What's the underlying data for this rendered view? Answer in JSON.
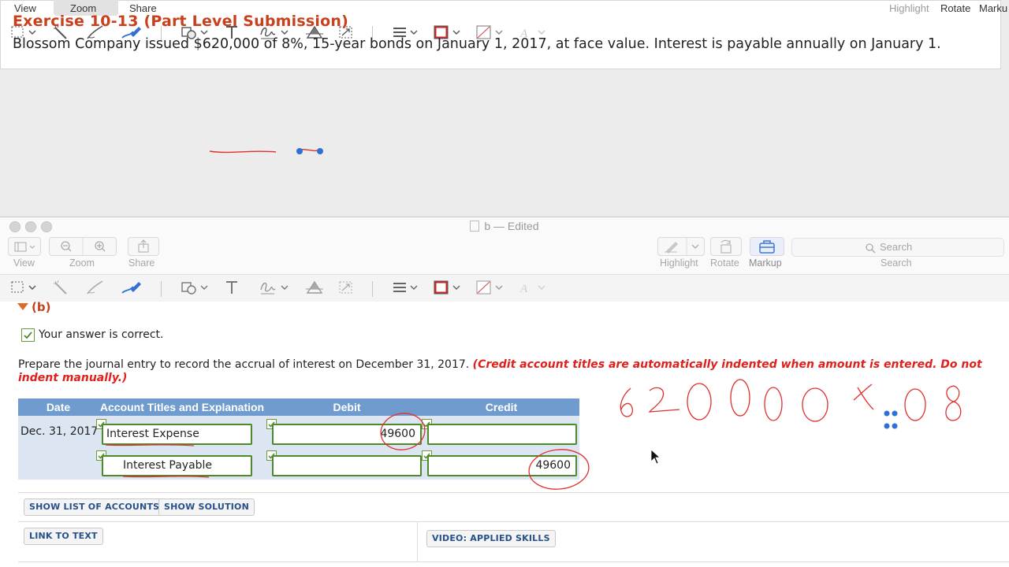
{
  "top_window": {
    "menu": {
      "view": "View",
      "zoom": "Zoom",
      "share": "Share",
      "highlight": "Highlight",
      "rotate": "Rotate",
      "markup": "Marku"
    },
    "exercise_title": "Exercise 10-13 (Part Level Submission)",
    "exercise_text": {
      "pre": "Blossom Company issued ",
      "amount": "$620,000",
      "mid": " of ",
      "rate": "8%",
      "post": ", 15-year bonds on January 1, 2017, at face value. Interest is payable annually on January 1."
    }
  },
  "front_window": {
    "title": "b — Edited",
    "toolbar": {
      "view": "View",
      "zoom": "Zoom",
      "share": "Share",
      "highlight": "Highlight",
      "rotate": "Rotate",
      "markup": "Markup",
      "search_placeholder": "Search",
      "search_label": "Search"
    },
    "part_label": "(b)",
    "correct_text": "Your answer is correct.",
    "instruction": "Prepare the journal entry to record the accrual of interest on December 31, 2017.",
    "instruction_note": "(Credit account titles are automatically indented when amount is entered. Do not indent manually.)",
    "journal": {
      "headers": [
        "Date",
        "Account Titles and Explanation",
        "Debit",
        "Credit"
      ],
      "date": "Dec. 31, 2017",
      "rows": [
        {
          "account": "Interest Expense",
          "debit": "49600",
          "credit": ""
        },
        {
          "account": "Interest Payable",
          "debit": "",
          "credit": "49600"
        }
      ]
    },
    "buttons": {
      "show_list": "SHOW LIST OF ACCOUNTS",
      "show_solution": "SHOW SOLUTION",
      "link_to_text": "LINK TO TEXT",
      "video": "VIDEO: APPLIED SKILLS"
    },
    "handwriting": "620000 x .08"
  },
  "colors": {
    "accent_red": "#c8401c",
    "note_red": "#e0201c",
    "table_header": "#6f9bcf",
    "table_bg": "#dce6f2",
    "input_border": "#4c8a2a",
    "ink": "#e03030"
  }
}
